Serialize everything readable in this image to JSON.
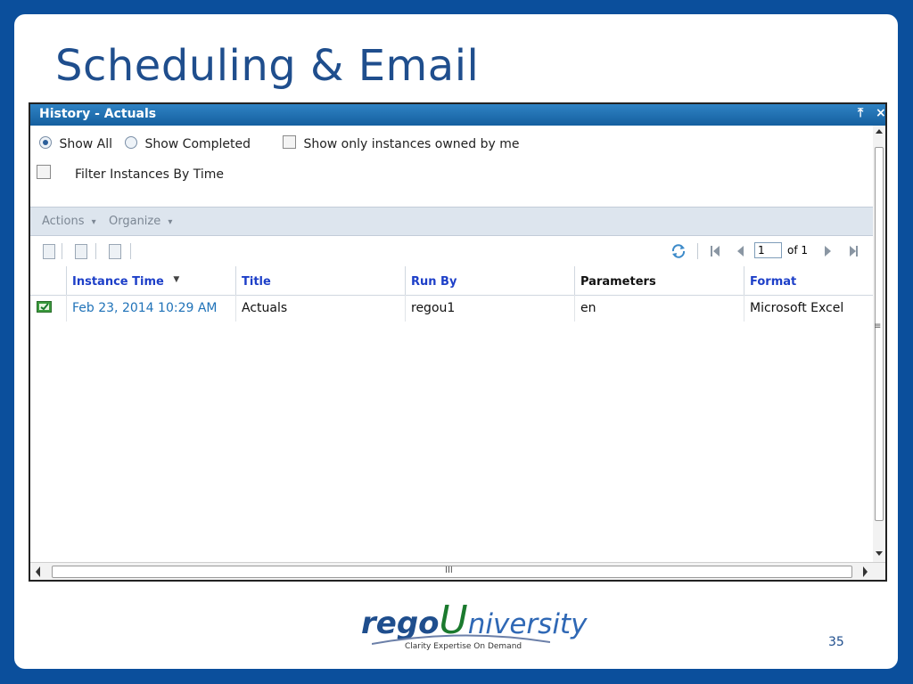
{
  "slide": {
    "title": "Scheduling & Email",
    "page_number": "35"
  },
  "window": {
    "title": "History - Actuals",
    "pin_glyph": "⤒",
    "close_glyph": "×"
  },
  "filters": {
    "show_all_label": "Show All",
    "show_all_selected": true,
    "show_completed_label": "Show Completed",
    "show_completed_selected": false,
    "owned_by_me_label": "Show only instances owned by me",
    "owned_by_me_checked": false,
    "filter_by_time_label": "Filter Instances By Time",
    "filter_by_time_checked": false
  },
  "menubar": {
    "actions_label": "Actions",
    "organize_label": "Organize",
    "dropdown_glyph": "▾"
  },
  "pager": {
    "current_page": "1",
    "of_label": "of 1"
  },
  "table": {
    "columns": [
      {
        "label": "Instance Time",
        "sortable": true,
        "sorted": "desc"
      },
      {
        "label": "Title",
        "sortable": true
      },
      {
        "label": "Run By",
        "sortable": true
      },
      {
        "label": "Parameters",
        "sortable": false
      },
      {
        "label": "Format",
        "sortable": true
      }
    ],
    "sort_glyph": "▼",
    "rows": [
      {
        "status_icon": "excel-file-icon",
        "instance_time": "Feb 23, 2014 10:29 AM",
        "title": "Actuals",
        "run_by": "regou1",
        "parameters": "en",
        "format": "Microsoft Excel"
      }
    ]
  },
  "scroll": {
    "grip_glyph": "III",
    "vgrip_glyph": "≡"
  },
  "logo": {
    "rego": "rego",
    "u": "U",
    "niversity": "niversity",
    "tagline": "Clarity Expertise On Demand"
  },
  "colors": {
    "slide_border": "#0b4f9c",
    "title_text": "#1f4e8d",
    "window_titlebar": "#1e6fb0",
    "link": "#1d3fc8",
    "logo_green": "#1b7a2e",
    "logo_blue": "#1f4e8d"
  }
}
